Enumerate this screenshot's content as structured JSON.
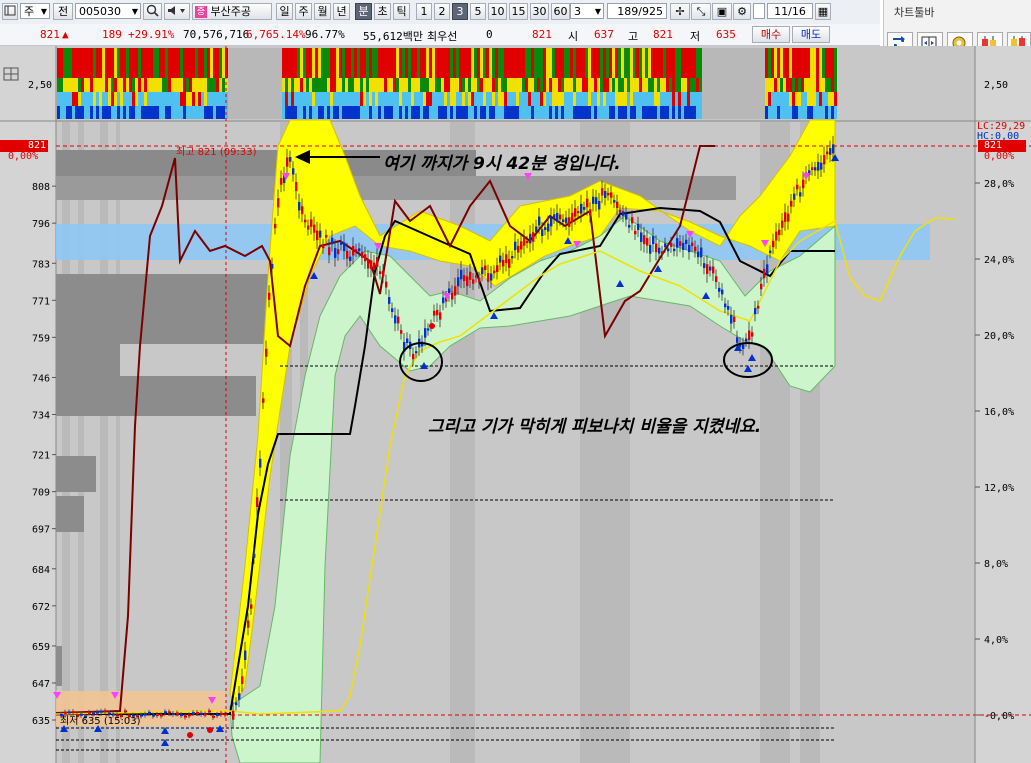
{
  "toolbar": {
    "market": "주",
    "type": "전",
    "code": "005030",
    "stock_name": "부산주공",
    "periods": [
      "일",
      "주",
      "월",
      "년",
      "분",
      "초",
      "틱"
    ],
    "selected_period": "분",
    "minutes": [
      "1",
      "2",
      "3",
      "5",
      "10",
      "15",
      "30",
      "60"
    ],
    "selected_minute": "3",
    "interval_value": "3",
    "page_counter": "189/925",
    "date": "11/16"
  },
  "quote": {
    "price": "821",
    "arrow": "▲",
    "change": "189",
    "change_pct": "+29.91%",
    "volume": "70,576,716",
    "volume_ratio": "6,765.14%",
    "strength": "96.77%",
    "amount": "55,612백만",
    "pref_label": "최우선",
    "pref_value": "0",
    "last": "821",
    "open_label": "시",
    "open": "637",
    "high_label": "고",
    "high": "821",
    "low_label": "저",
    "low": "635",
    "buy_label": "매수",
    "sell_label": "매도"
  },
  "chart_toolbar": {
    "title": "차트툴바",
    "icons": [
      "refresh-icon",
      "compare-icon",
      "settings-icon",
      "candle-chart-icon",
      "candle-chart-alt-icon"
    ]
  },
  "chart": {
    "upper_axis_label": "2,50",
    "right_upper_axis_label": "2,50",
    "price_ticks": [
      "821",
      "808",
      "796",
      "783",
      "771",
      "759",
      "746",
      "734",
      "721",
      "709",
      "697",
      "684",
      "672",
      "659",
      "647",
      "635"
    ],
    "current_price_tag": "821",
    "current_pct_tag": "0,00%",
    "right_current_tag": "821",
    "right_current_pct": "0,00%",
    "lc_label": "LC:29,29",
    "hc_label": "HC:0,00",
    "pct_ticks": [
      "28,0%",
      "24,0%",
      "20,0%",
      "16,0%",
      "12,0%",
      "8,0%",
      "4,0%",
      "-0,0%"
    ],
    "high_note": "최고 821 (09:33)",
    "low_note": "최저 635 (15:03)",
    "annotation_1": "여기 까지가 9시 42분 경입니다.",
    "annotation_2": "그리고 기가 막히게 피보나치 비율을 지켰네요."
  },
  "colors": {
    "up": "#e00000",
    "down": "#0030d0",
    "band_yellow": "#ffff00",
    "band_green": "#ccf5cc",
    "zone_blue": "#8ec8f5",
    "bg_gray": "#c0c0c0"
  }
}
